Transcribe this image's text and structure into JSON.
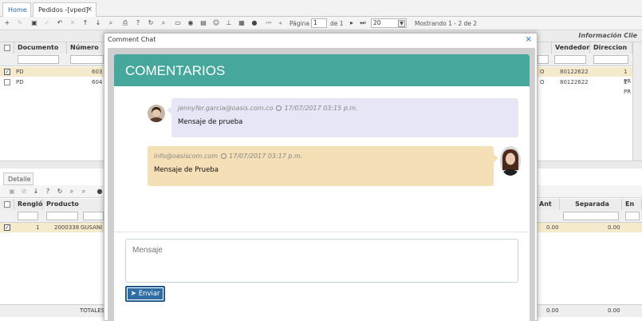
{
  "tabs": {
    "home": "Home",
    "pedidos": "Pedidos -[vped]",
    "close": "×"
  },
  "pager": {
    "pagina_label": "Página",
    "page_value": "1",
    "de_label": "de 1",
    "page_size": "20",
    "showing": "Mostrando 1 - 2 de 2"
  },
  "grid": {
    "info_title": "Información Clie",
    "columns_left": [
      "Documento",
      "Número"
    ],
    "columns_right": [
      "Vendedor",
      "Direccion"
    ],
    "rows": [
      {
        "doc": "PD",
        "num": "603",
        "right_a": "O",
        "vendedor": "80122622",
        "dir": "1 PR",
        "selected": true
      },
      {
        "doc": "PD",
        "num": "604",
        "right_a": "O",
        "vendedor": "80122622",
        "dir": "1 PR",
        "selected": false
      }
    ]
  },
  "detail": {
    "tab_label": "Detalle",
    "columns_left": [
      "Renglón",
      "Producto"
    ],
    "columns_right": [
      "Ant",
      "Separada",
      "En"
    ],
    "row": {
      "renglon": "1",
      "producto": "2000338",
      "desc": "GUSANI",
      "ant": "0.00",
      "separada": "0.00"
    },
    "totals_label": "TOTALES",
    "totals": [
      "0.00",
      "0.00"
    ]
  },
  "dialog": {
    "title": "Comment Chat",
    "close": "×",
    "header": "COMENTARIOS",
    "messages": [
      {
        "author": "jennyfer.garcia@oasis.com.co",
        "time": "17/07/2017 03:15 p.m.",
        "text": "Mensaje de prueba",
        "side": "left"
      },
      {
        "author": "info@oasiscom.com",
        "time": "17/07/2017 03:17 p.m.",
        "text": "Mensaje de Prueba",
        "side": "right"
      }
    ],
    "input_placeholder": "Mensaje",
    "send_label": "Enviar"
  },
  "colors": {
    "header_teal": "#46a79c",
    "bubble_left": "#e6e6f6",
    "bubble_right": "#f5dfb6",
    "send_blue": "#2f6da4",
    "row_selected": "#f5ebcc"
  }
}
